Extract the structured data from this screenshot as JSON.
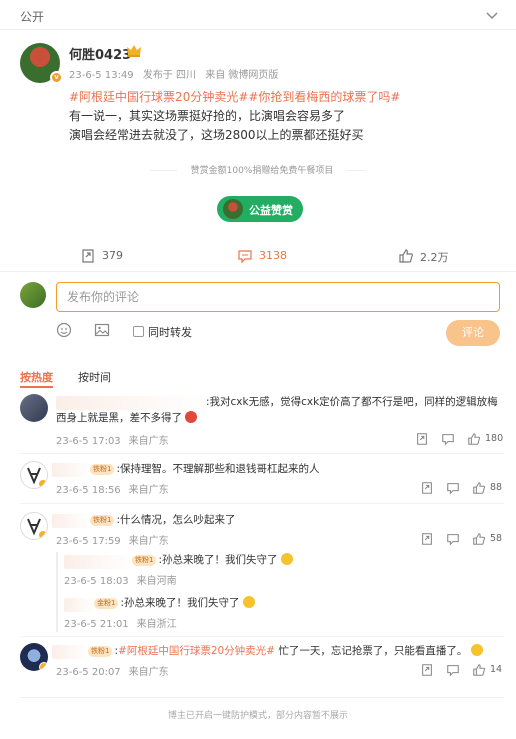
{
  "top": {
    "visibility": "公开"
  },
  "post": {
    "username": "何胜0423",
    "date": "23-6-5 13:49",
    "location": "发布于 四川",
    "source": "来自 微博网页版",
    "tags": "#阿根廷中国行球票20分钟卖光##你抢到看梅西的球票了吗#",
    "lines": [
      "有一说一，其实这场票挺好抢的，比演唱会容易多了",
      "演唱会经常进去就没了，这场2800以上的票都还挺好买"
    ]
  },
  "sponsor": {
    "text": "赞赏金额100%捐赠给免费午餐项目",
    "button": "公益赞赏"
  },
  "actions": {
    "repost": "379",
    "comment": "3138",
    "like": "2.2万"
  },
  "compose": {
    "placeholder": "发布你的评论",
    "repost_label": "同时转发",
    "submit_label": "评论"
  },
  "sort": {
    "hot": "按热度",
    "time": "按时间"
  },
  "comments": [
    {
      "text": ":我对cxk无感，觉得cxk定价高了都不行是吧，同样的逻辑放梅",
      "text2": "西身上就是黑，差不多得了",
      "time": "23-6-5 17:03",
      "loc": "来自广东",
      "likes": "180"
    },
    {
      "badge": "铁粉1",
      "text": ":保持理智。不理解那些和退钱哥杠起来的人",
      "time": "23-6-5 18:56",
      "loc": "来自广东",
      "likes": "88"
    },
    {
      "badge": "铁粉1",
      "text": ":什么情况，怎么吵起来了",
      "time": "23-6-5 17:59",
      "loc": "来自广东",
      "likes": "58",
      "replies": [
        {
          "badge": "铁粉1",
          "text": ":孙总来晚了！我们失守了",
          "time": "23-6-5 18:03",
          "loc": "来自河南"
        },
        {
          "badge": "金粉1",
          "text": ":孙总来晚了！我们失守了",
          "time": "23-6-5 21:01",
          "loc": "来自浙江"
        }
      ]
    },
    {
      "badge": "铁粉1",
      "tag": "#阿根廷中国行球票20分钟卖光#",
      "text": " 忙了一天，忘记抢票了，只能看直播了。",
      "time": "23-6-5 20:07",
      "loc": "来自广东",
      "likes": "14"
    }
  ],
  "footer": "博主已开启一键防护模式，部分内容暂不展示",
  "colors": {
    "accent": "#eb7350",
    "reward": "#22ad62",
    "submit": "#f9c38c"
  }
}
